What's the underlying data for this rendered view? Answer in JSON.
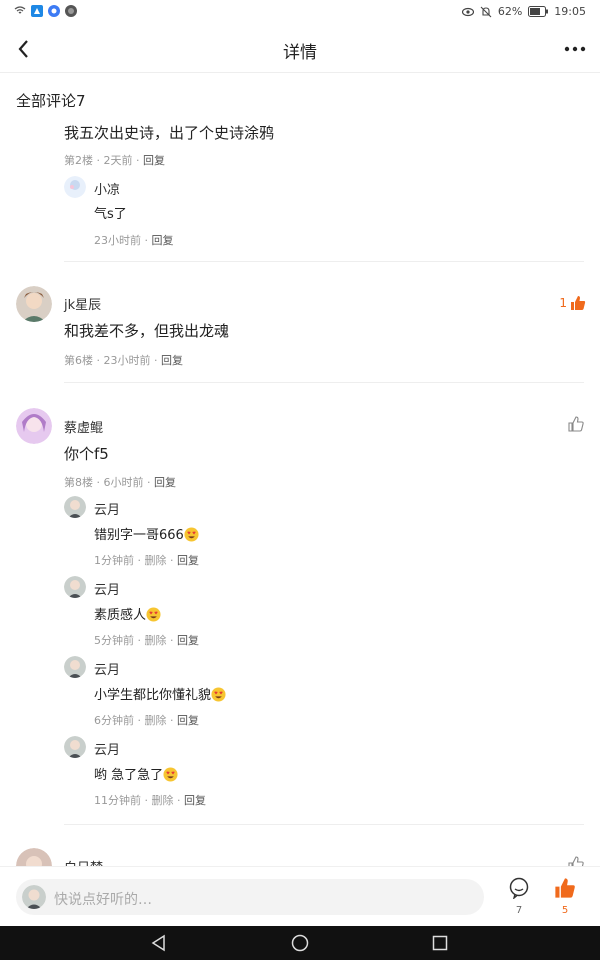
{
  "status_bar": {
    "battery": "62%",
    "time": "19:05"
  },
  "header": {
    "title": "详情"
  },
  "comments_header": "全部评论7",
  "partial_top": {
    "text": "我五次出史诗，出了个史诗涂鸦",
    "floor": "第2楼",
    "time": "2天前",
    "reply_label": "回复",
    "reply": {
      "user": "小凉",
      "text": "气s了",
      "time": "23小时前",
      "reply_label": "回复"
    }
  },
  "comment_6": {
    "user": "jk星辰",
    "text": "和我差不多，但我出龙魂",
    "floor": "第6楼",
    "time": "23小时前",
    "reply_label": "回复",
    "likes": "1"
  },
  "comment_8": {
    "user": "蔡虚鲲",
    "text": "你个f5",
    "floor": "第8楼",
    "time": "6小时前",
    "reply_label": "回复",
    "replies": [
      {
        "user": "云月",
        "text": "错别字一哥666",
        "time": "1分钟前",
        "delete_label": "删除",
        "reply_label": "回复"
      },
      {
        "user": "云月",
        "text": "素质感人",
        "time": "5分钟前",
        "delete_label": "删除",
        "reply_label": "回复"
      },
      {
        "user": "云月",
        "text": "小学生都比你懂礼貌",
        "time": "6分钟前",
        "delete_label": "删除",
        "reply_label": "回复"
      },
      {
        "user": "云月",
        "text": "哟 急了急了",
        "time": "11分钟前",
        "delete_label": "删除",
        "reply_label": "回复"
      }
    ]
  },
  "partial_bottom": {
    "user": "白日梦"
  },
  "bottom_bar": {
    "placeholder": "快说点好听的…",
    "comment_count": "7",
    "like_count": "5"
  },
  "colors": {
    "accent": "#f06a1c",
    "meta": "#999999"
  },
  "icons": {
    "back": "back-arrow-icon",
    "more": "more-dots-icon",
    "like": "thumbs-up-icon",
    "comment": "comment-bubble-icon",
    "emoji": "heart-eyes-emoji-icon"
  }
}
